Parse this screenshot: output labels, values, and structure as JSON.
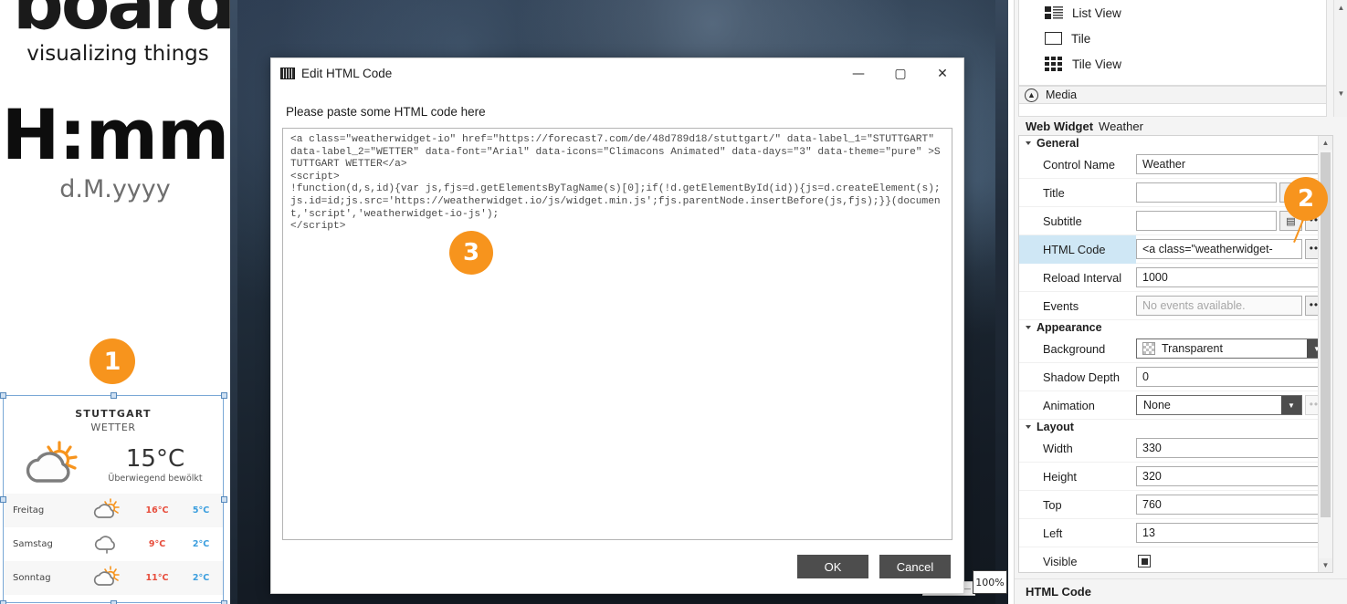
{
  "left_canvas": {
    "logo_word": "board",
    "logo_tagline": "visualizing things",
    "clock_time": "H:mm",
    "clock_date": "d.M.yyyy"
  },
  "weather_widget": {
    "city": "STUTTGART",
    "subtitle": "WETTER",
    "current_temp": "15°C",
    "current_desc": "Überwiegend bewölkt",
    "forecast": [
      {
        "day": "Freitag",
        "icon": "sun-cloud-icon",
        "high": "16°C",
        "low": "5°C"
      },
      {
        "day": "Samstag",
        "icon": "cloud-icon",
        "high": "9°C",
        "low": "2°C"
      },
      {
        "day": "Sonntag",
        "icon": "sun-cloud-icon",
        "high": "11°C",
        "low": "2°C"
      }
    ]
  },
  "badges": {
    "one": "1",
    "two": "2",
    "three": "3",
    "color": "#f7941d"
  },
  "dialog": {
    "title": "Edit HTML Code",
    "prompt": "Please paste some HTML code here",
    "code": "<a class=\"weatherwidget-io\" href=\"https://forecast7.com/de/48d789d18/stuttgart/\" data-label_1=\"STUTTGART\" data-label_2=\"WETTER\" data-font=\"Arial\" data-icons=\"Climacons Animated\" data-days=\"3\" data-theme=\"pure\" >STUTTGART WETTER</a>\n<script>\n!function(d,s,id){var js,fjs=d.getElementsByTagName(s)[0];if(!d.getElementById(id)){js=d.createElement(s);js.id=id;js.src='https://weatherwidget.io/js/widget.min.js';fjs.parentNode.insertBefore(js,fjs);}}(document,'script','weatherwidget-io-js');\n</script>",
    "minimize_label": "—",
    "maximize_label": "▢",
    "close_label": "✕",
    "ok_label": "OK",
    "cancel_label": "Cancel"
  },
  "canvas": {
    "zoom_level": "100%"
  },
  "toolbox": {
    "items": [
      {
        "label": "List View",
        "icon": "list-view-icon"
      },
      {
        "label": "Tile",
        "icon": "tile-icon"
      },
      {
        "label": "Tile View",
        "icon": "tile-view-icon"
      }
    ],
    "media_group": "Media"
  },
  "properties": {
    "header_type": "Web Widget",
    "header_name": "Weather",
    "footer_label": "HTML Code",
    "groups": [
      {
        "name": "General",
        "rows": [
          {
            "label": "Control Name",
            "kind": "text",
            "value": "Weather",
            "dots": false
          },
          {
            "label": "Title",
            "kind": "text",
            "value": "",
            "dots": true,
            "fx": true
          },
          {
            "label": "Subtitle",
            "kind": "text",
            "value": "",
            "dots": true,
            "fx": true
          },
          {
            "label": "HTML Code",
            "kind": "text",
            "value": "<a class=\"weatherwidget-",
            "dots": true,
            "selected": true
          },
          {
            "label": "Reload Interval",
            "kind": "text",
            "value": "1000",
            "dots": false
          },
          {
            "label": "Events",
            "kind": "text",
            "value": "No events available.",
            "dots": true,
            "muted": true
          }
        ]
      },
      {
        "name": "Appearance",
        "rows": [
          {
            "label": "Background",
            "kind": "combo",
            "value": "Transparent",
            "swatch": true
          },
          {
            "label": "Shadow Depth",
            "kind": "text",
            "value": "0"
          },
          {
            "label": "Animation",
            "kind": "combo",
            "value": "None",
            "dots": true,
            "dots_disabled": true
          }
        ]
      },
      {
        "name": "Layout",
        "rows": [
          {
            "label": "Width",
            "kind": "text",
            "value": "330"
          },
          {
            "label": "Height",
            "kind": "text",
            "value": "320"
          },
          {
            "label": "Top",
            "kind": "text",
            "value": "760"
          },
          {
            "label": "Left",
            "kind": "text",
            "value": "13"
          },
          {
            "label": "Visible",
            "kind": "checkbox",
            "value": "checked"
          }
        ]
      }
    ]
  }
}
